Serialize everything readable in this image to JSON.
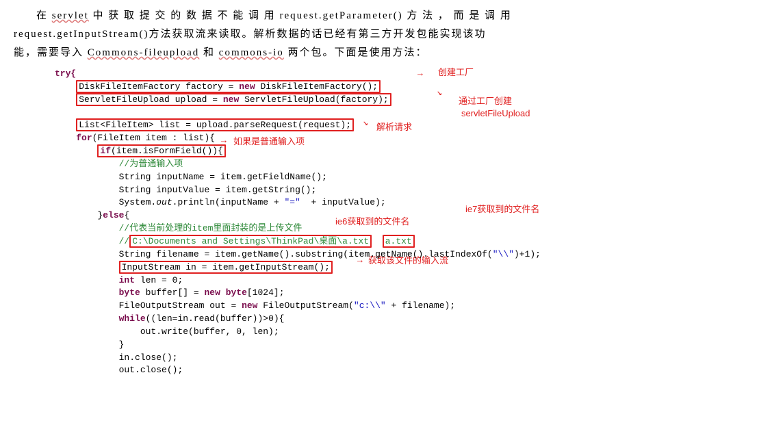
{
  "para": {
    "line1_a": "在 ",
    "servlet": "servlet",
    "line1_b": " 中 获 取 提 交 的 数 据 不 能 调 用 request.getParameter() 方 法 ， 而 是 调 用",
    "line2_a": "request.getInputStream()方法获取流来读取。解析数据的话已经有第三方开发包能实现该功",
    "line3_a": "能，需要导入 ",
    "commons_fu": "Commons-fileupload",
    "and": " 和 ",
    "commons_io": "commons-io",
    "line3_b": " 两个包。下面是使用方法："
  },
  "code": {
    "l1": "try{",
    "l2_box": "DiskFileItemFactory factory = new DiskFileItemFactory();",
    "l3_box": "ServletFileUpload upload = new ServletFileUpload(factory);",
    "l5_box": "List<FileItem> list = upload.parseRequest(request);",
    "l6_for": "for",
    "l6_rest": "(FileItem item : list){",
    "l7_if": "if",
    "l7_cond": "(item.isFormField()){",
    "l8_comment": "//为普通输入项",
    "l9": "String inputName = item.getFieldName();",
    "l10": "String inputValue = item.getString();",
    "l11_a": "System.",
    "l11_out": "out",
    "l11_b": ".println(inputName + ",
    "l11_str": "\"=\"",
    "l11_c": "  + inputValue);",
    "l12": "}",
    "l12_else": "else",
    "l12b": "{",
    "l13_comment": "//代表当前处理的item里面封装的是上传文件",
    "l14_comment_a": "//",
    "l14_path": "C:\\Documents and Settings\\ThinkPad\\桌面\\a.txt",
    "l14_atxt": "a.txt",
    "l15_a": "String filename = item.getName().substring(item.getName().lastIndexOf(",
    "l15_str": "\"\\\\\"",
    "l15_b": ")+1);",
    "l16_box": "InputStream in = item.getInputStream();",
    "l17_int": "int",
    "l17_b": " len = 0;",
    "l18_byte": "byte",
    "l18_b": " buffer[] = ",
    "l18_new": "new",
    "l18_c": " ",
    "l18_byte2": "byte",
    "l18_d": "[1024];",
    "l19_a": "FileOutputStream out = ",
    "l19_new": "new",
    "l19_b": " FileOutputStream(",
    "l19_str": "\"c:\\\\\"",
    "l19_c": " + filename);",
    "l20_while": "while",
    "l20_b": "((len=in.read(buffer))>0){",
    "l21": "out.write(buffer, 0, len);",
    "l22": "}",
    "l23": "in.close();",
    "l24": "out.close();"
  },
  "callouts": {
    "factory": "创建工厂",
    "sfu_a": "通过工厂创建",
    "sfu_b": "servletFileUpload",
    "parse": "解析请求",
    "formfield": "如果是普通输入项",
    "ie6": "ie6获取到的文件名",
    "ie7": "ie7获取到的文件名",
    "inputstream": "获取该文件的输入流"
  }
}
